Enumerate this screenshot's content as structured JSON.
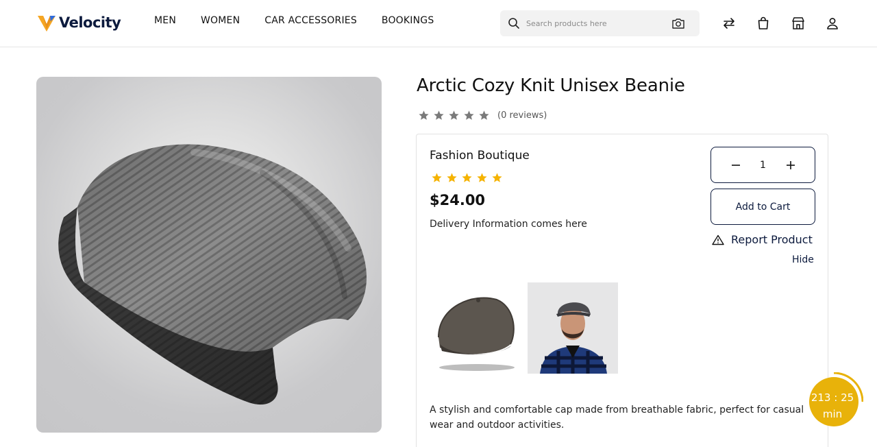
{
  "header": {
    "brand": "Velocity",
    "nav": [
      "MEN",
      "WOMEN",
      "CAR ACCESSORIES",
      "BOOKINGS"
    ],
    "search_placeholder": "Search products here",
    "icons": [
      "compare-arrows-icon",
      "shopping-bag-icon",
      "store-icon",
      "user-icon"
    ]
  },
  "product": {
    "title": "Arctic Cozy Knit Unisex Beanie",
    "reviews_text": "(0 reviews)",
    "rating": 0,
    "rating_max": 5,
    "seller": "Fashion Boutique",
    "seller_rating": 5,
    "price": "$24.00",
    "delivery": "Delivery Information comes here",
    "quantity": "1",
    "add_to_cart": "Add to Cart",
    "report": "Report Product",
    "hide": "Hide",
    "description": "A stylish and comfortable cap made from breathable fabric, perfect for casual wear and outdoor activities."
  },
  "timer": {
    "value": "213 : 25",
    "unit": "min"
  },
  "colors": {
    "brand_navy": "#0c1a3d",
    "star_gold": "#f5b301",
    "star_gray": "#7a7a7a",
    "timer_gold": "#e8b20a"
  }
}
